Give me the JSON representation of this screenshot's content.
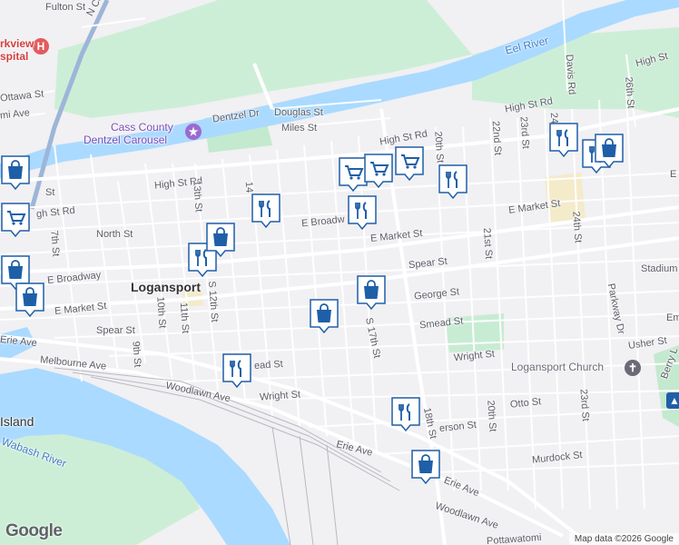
{
  "city": "Logansport",
  "water": {
    "eel_river": "Eel River",
    "wabash_river": "Wabash River"
  },
  "places": {
    "carousel_line1": "Cass County",
    "carousel_line2": "Dentzel Carousel",
    "hospital_line1": "rkview",
    "hospital_line2": "spital",
    "church": "Logansport Church",
    "island": "Island"
  },
  "streets": {
    "fulton": "Fulton St",
    "n_cicott": "N Co",
    "ottawa": "Ottawa St",
    "miami": "mi Ave",
    "dentzel": "Dentzel Dr",
    "douglas": "Douglas St",
    "miles": "Miles St",
    "high_st_rd_e": "High St Rd",
    "high_st_rd_mid": "High St Rd",
    "high_st_rd_w": "High St Rd",
    "high_st_ne": "High St",
    "davis": "Davis Rd",
    "st_26": "26th St",
    "st_24_top": "24",
    "st_23_top": "23rd St",
    "st_22_top": "22nd St",
    "st_20_top": "20th St",
    "st_14": "14",
    "st_13": "13th St",
    "north": "North St",
    "e_broadway_mid": "E Broadw",
    "e_market_mid": "E Market St",
    "e_market_east": "E Market St",
    "e_market_far": "E",
    "e_broadway_west": "E Broadway",
    "e_market_west": "E Market St",
    "spear_east": "Spear St",
    "stadium": "Stadium",
    "st_21": "21st St",
    "st_24": "24th St",
    "george": "George St",
    "parkway": "Parkway Dr",
    "st_17": "S 17th St",
    "smead_east": "Smead St",
    "usher": "Usher St",
    "em": "Em",
    "wright_east": "Wright St",
    "berry": "Berry L",
    "st_20": "20th St",
    "otto": "Otto St",
    "st_23": "23rd St",
    "st_18": "18th St",
    "jefferson": "erson St",
    "murdock": "Murdock St",
    "erie_east": "Erie Ave",
    "woodlawn_east": "Woodlawn Ave",
    "pottawatomie": "Pottawatomi",
    "erie_mid": "Erie Ave",
    "erie_west": "Erie Ave",
    "melbourne": "Melbourne Ave",
    "woodlawn_west": "Woodlawn Ave",
    "wright_west": "Wright St",
    "smead_west": "ead St",
    "spear_west": "Spear St",
    "st_10": "10th St",
    "st_11": "11th St",
    "st_12": "S 12th St",
    "st_9": "9th St",
    "st_7": "7th St",
    "st_w": "St",
    "high_st_rd_far_w": "gh St Rd"
  },
  "markers": [
    {
      "type": "grocery"
    },
    {
      "type": "grocery"
    },
    {
      "type": "grocery"
    },
    {
      "type": "grocery"
    },
    {
      "type": "restaurant"
    },
    {
      "type": "restaurant"
    },
    {
      "type": "restaurant"
    },
    {
      "type": "restaurant"
    },
    {
      "type": "restaurant"
    },
    {
      "type": "restaurant"
    },
    {
      "type": "restaurant"
    },
    {
      "type": "restaurant"
    },
    {
      "type": "shopping"
    },
    {
      "type": "shopping"
    },
    {
      "type": "shopping"
    },
    {
      "type": "shopping"
    },
    {
      "type": "shopping"
    },
    {
      "type": "shopping"
    },
    {
      "type": "shopping"
    },
    {
      "type": "shopping"
    }
  ],
  "colors": {
    "marker_fill": "#1f5fa8",
    "marker_bg": "#ffffff",
    "water": "#aadaff",
    "park": "#c7ecd3"
  },
  "attribution": "Map data ©2026 Google",
  "logo": "Google"
}
